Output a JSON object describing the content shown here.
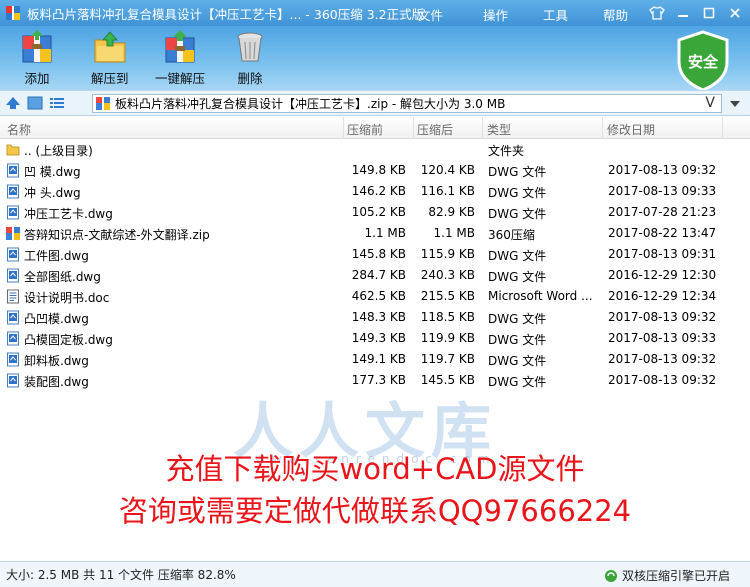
{
  "window": {
    "title": "板料凸片落料冲孔复合模具设计【冲压工艺卡】... - 360压缩 3.2正式版",
    "menus": [
      "文件",
      "操作",
      "工具",
      "帮助"
    ]
  },
  "toolbar": {
    "add_label": "添加",
    "extract_label": "解压到",
    "oneclick_label": "一键解压",
    "delete_label": "删除",
    "safe_label": "安全"
  },
  "address": {
    "text": "板料凸片落料冲孔复合模具设计【冲压工艺卡】.zip - 解包大小为 3.0 MB",
    "v_glyph": "V"
  },
  "columns": {
    "name": "名称",
    "size": "压缩前",
    "csize": "压缩后",
    "type": "类型",
    "date": "修改日期"
  },
  "files": [
    {
      "icon": "folder",
      "name": ".. (上级目录)",
      "size": "",
      "csize": "",
      "type": "文件夹",
      "date": ""
    },
    {
      "icon": "dwg",
      "name": "凹  模.dwg",
      "size": "149.8 KB",
      "csize": "120.4 KB",
      "type": "DWG 文件",
      "date": "2017-08-13 09:32"
    },
    {
      "icon": "dwg",
      "name": "冲  头.dwg",
      "size": "146.2 KB",
      "csize": "116.1 KB",
      "type": "DWG 文件",
      "date": "2017-08-13 09:33"
    },
    {
      "icon": "dwg",
      "name": "冲压工艺卡.dwg",
      "size": "105.2 KB",
      "csize": "82.9 KB",
      "type": "DWG 文件",
      "date": "2017-07-28 21:23"
    },
    {
      "icon": "zip",
      "name": "答辩知识点-文献综述-外文翻译.zip",
      "size": "1.1 MB",
      "csize": "1.1 MB",
      "type": "360压缩",
      "date": "2017-08-22 13:47"
    },
    {
      "icon": "dwg",
      "name": "工件图.dwg",
      "size": "145.8 KB",
      "csize": "115.9 KB",
      "type": "DWG 文件",
      "date": "2017-08-13 09:31"
    },
    {
      "icon": "dwg",
      "name": "全部图纸.dwg",
      "size": "284.7 KB",
      "csize": "240.3 KB",
      "type": "DWG 文件",
      "date": "2016-12-29 12:30"
    },
    {
      "icon": "doc",
      "name": "设计说明书.doc",
      "size": "462.5 KB",
      "csize": "215.5 KB",
      "type": "Microsoft Word ...",
      "date": "2016-12-29 12:34"
    },
    {
      "icon": "dwg",
      "name": "凸凹模.dwg",
      "size": "148.3 KB",
      "csize": "118.5 KB",
      "type": "DWG 文件",
      "date": "2017-08-13 09:32"
    },
    {
      "icon": "dwg",
      "name": "凸模固定板.dwg",
      "size": "149.3 KB",
      "csize": "119.9 KB",
      "type": "DWG 文件",
      "date": "2017-08-13 09:33"
    },
    {
      "icon": "dwg",
      "name": "卸料板.dwg",
      "size": "149.1 KB",
      "csize": "119.7 KB",
      "type": "DWG 文件",
      "date": "2017-08-13 09:32"
    },
    {
      "icon": "dwg",
      "name": "装配图.dwg",
      "size": "177.3 KB",
      "csize": "145.5 KB",
      "type": "DWG 文件",
      "date": "2017-08-13 09:32"
    }
  ],
  "watermark": {
    "text": "人人文库",
    "url": "www.renrendoc.com"
  },
  "promo": {
    "line1": "充值下载购买word+CAD源文件",
    "line2": "咨询或需要定做代做联系QQ97666224"
  },
  "status": {
    "left": "大小: 2.5 MB 共 11 个文件 压缩率 82.8%",
    "right": "双核压缩引擎已开启"
  },
  "colors": {
    "accent": "#3f92d6",
    "promo": "#e8151b",
    "safe": "#3aa63a"
  }
}
